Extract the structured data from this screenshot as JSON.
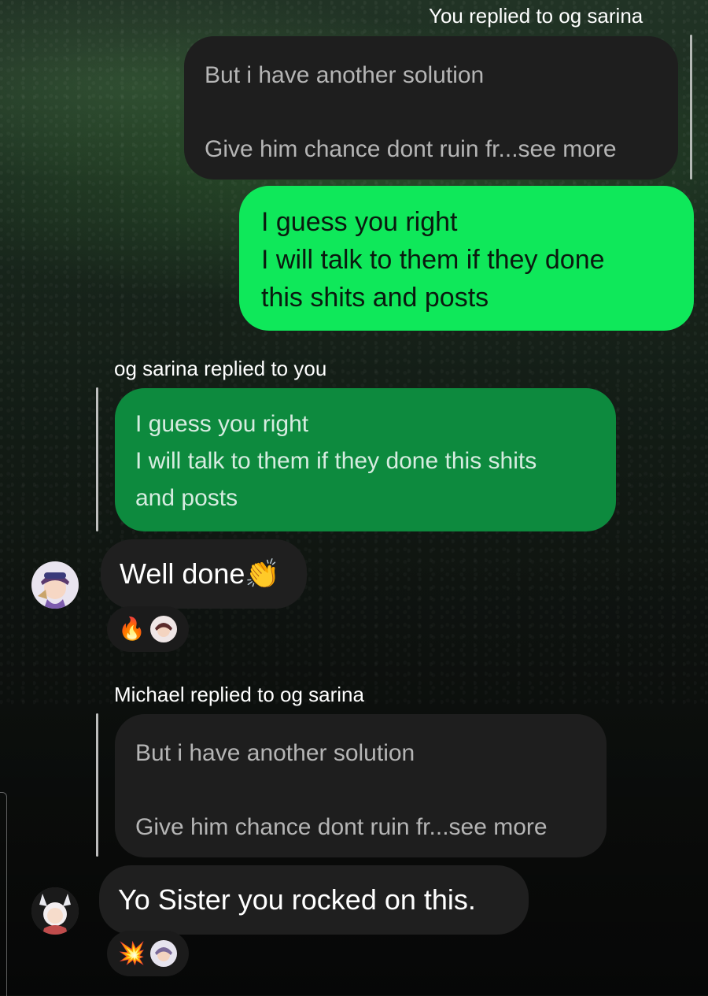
{
  "messages": [
    {
      "label": "You replied to og sarina",
      "quoted_lines": [
        "But i have another solution",
        "Give him chance dont ruin fr...see more"
      ]
    },
    {
      "own_text_lines": [
        "I guess you right",
        "I will talk to them if they done",
        "this shits and posts"
      ]
    },
    {
      "label": "og sarina replied to you",
      "quoted_lines": [
        "I guess you right",
        "I will talk to them if they done this shits",
        "and posts"
      ]
    },
    {
      "text": "Well done👏",
      "reactions": [
        "🔥"
      ]
    },
    {
      "label": "Michael replied to og sarina",
      "quoted_lines": [
        "But i have another solution",
        "Give him chance dont ruin fr...see more"
      ]
    },
    {
      "text": "Yo Sister you rocked on this.",
      "reactions": [
        "💥"
      ]
    }
  ],
  "avatars": {
    "sender_1": "anime-girl-avatar",
    "sender_2": "white-hair-anime-avatar",
    "reactor": "reactor-avatar"
  },
  "colors": {
    "own_bubble": "#0fe85a",
    "quoted_green": "#0d8a3e",
    "dark_bubble": "#1e1e1e"
  }
}
